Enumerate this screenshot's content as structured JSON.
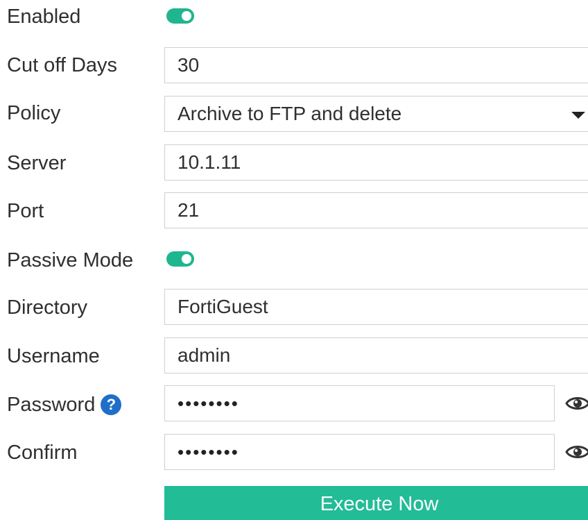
{
  "form": {
    "enabled": {
      "label": "Enabled",
      "value": true
    },
    "cutoff_days": {
      "label": "Cut off Days",
      "value": "30"
    },
    "policy": {
      "label": "Policy",
      "value": "Archive to FTP and delete"
    },
    "server": {
      "label": "Server",
      "value": "10.1.11"
    },
    "port": {
      "label": "Port",
      "value": "21"
    },
    "passive_mode": {
      "label": "Passive Mode",
      "value": true
    },
    "directory": {
      "label": "Directory",
      "value": "FortiGuest"
    },
    "username": {
      "label": "Username",
      "value": "admin"
    },
    "password": {
      "label": "Password",
      "masked": "••••••••",
      "help_icon": "question-circle-icon",
      "reveal_icon": "eye-icon"
    },
    "confirm": {
      "label": "Confirm",
      "masked": "••••••••",
      "reveal_icon": "eye-icon"
    },
    "execute_button": {
      "label": "Execute Now"
    }
  },
  "colors": {
    "toggle_on": "#1fb68f",
    "button": "#22bc97",
    "help_icon": "#1f6fc9",
    "field_border": "#cfcfcf"
  }
}
